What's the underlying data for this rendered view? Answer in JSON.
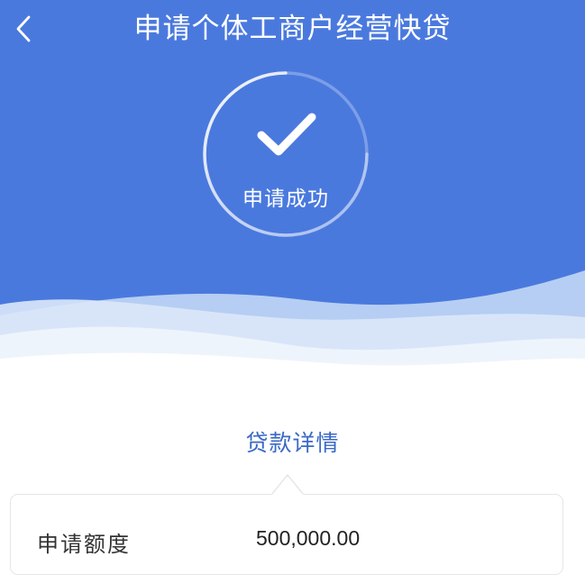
{
  "header": {
    "title": "申请个体工商户经营快贷",
    "back_icon": "chevron-left-icon"
  },
  "status": {
    "icon": "checkmark-icon",
    "text": "申请成功"
  },
  "details": {
    "section_title": "贷款详情",
    "rows": [
      {
        "label": "申请额度",
        "value": "500,000.00"
      }
    ]
  },
  "colors": {
    "header_bg": "#4a79de",
    "accent_text": "#3a69c6"
  }
}
